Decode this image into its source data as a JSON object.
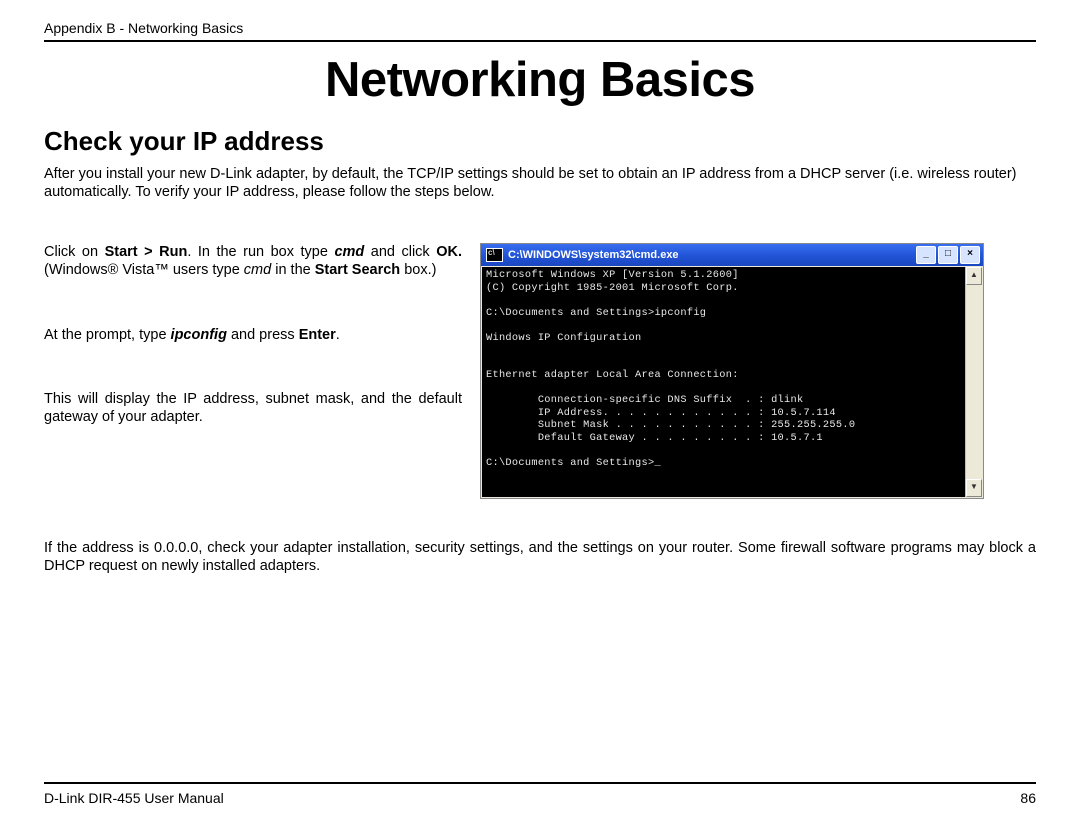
{
  "header": "Appendix B - Networking Basics",
  "title": "Networking Basics",
  "subtitle": "Check your IP address",
  "intro": "After you install your new D-Link adapter, by default, the TCP/IP settings should be set to obtain an IP address from a DHCP server (i.e. wireless router) automatically. To verify your IP address, please follow the steps below.",
  "step1": {
    "t1": "Click on ",
    "b1": "Start > Run",
    "t2": ". In the run box type ",
    "bi1": "cmd",
    "t3": " and click ",
    "b2": "OK.",
    "t4": " (Windows® Vista™ users type ",
    "i1": "cmd",
    "t5": " in the ",
    "b3": "Start Search",
    "t6": " box.)"
  },
  "step2": {
    "t1": "At the prompt, type ",
    "bi1": "ipconfig",
    "t2": " and press ",
    "b1": "Enter",
    "t3": "."
  },
  "step3": "This will display the IP address, subnet mask, and the default gateway of your adapter.",
  "bottom": "If the address is 0.0.0.0, check your adapter installation, security settings, and the settings on your router. Some firewall software programs may block a DHCP request on newly installed adapters.",
  "footer": {
    "left": "D-Link DIR-455 User Manual",
    "right": "86"
  },
  "cmd": {
    "icon_glyph": "c\\",
    "title": "C:\\WINDOWS\\system32\\cmd.exe",
    "min": "_",
    "max": "□",
    "close": "×",
    "up": "▲",
    "down": "▼",
    "lines": "Microsoft Windows XP [Version 5.1.2600]\n(C) Copyright 1985-2001 Microsoft Corp.\n\nC:\\Documents and Settings>ipconfig\n\nWindows IP Configuration\n\n\nEthernet adapter Local Area Connection:\n\n        Connection-specific DNS Suffix  . : dlink\n        IP Address. . . . . . . . . . . . : 10.5.7.114\n        Subnet Mask . . . . . . . . . . . : 255.255.255.0\n        Default Gateway . . . . . . . . . : 10.5.7.1\n\nC:\\Documents and Settings>_"
  }
}
